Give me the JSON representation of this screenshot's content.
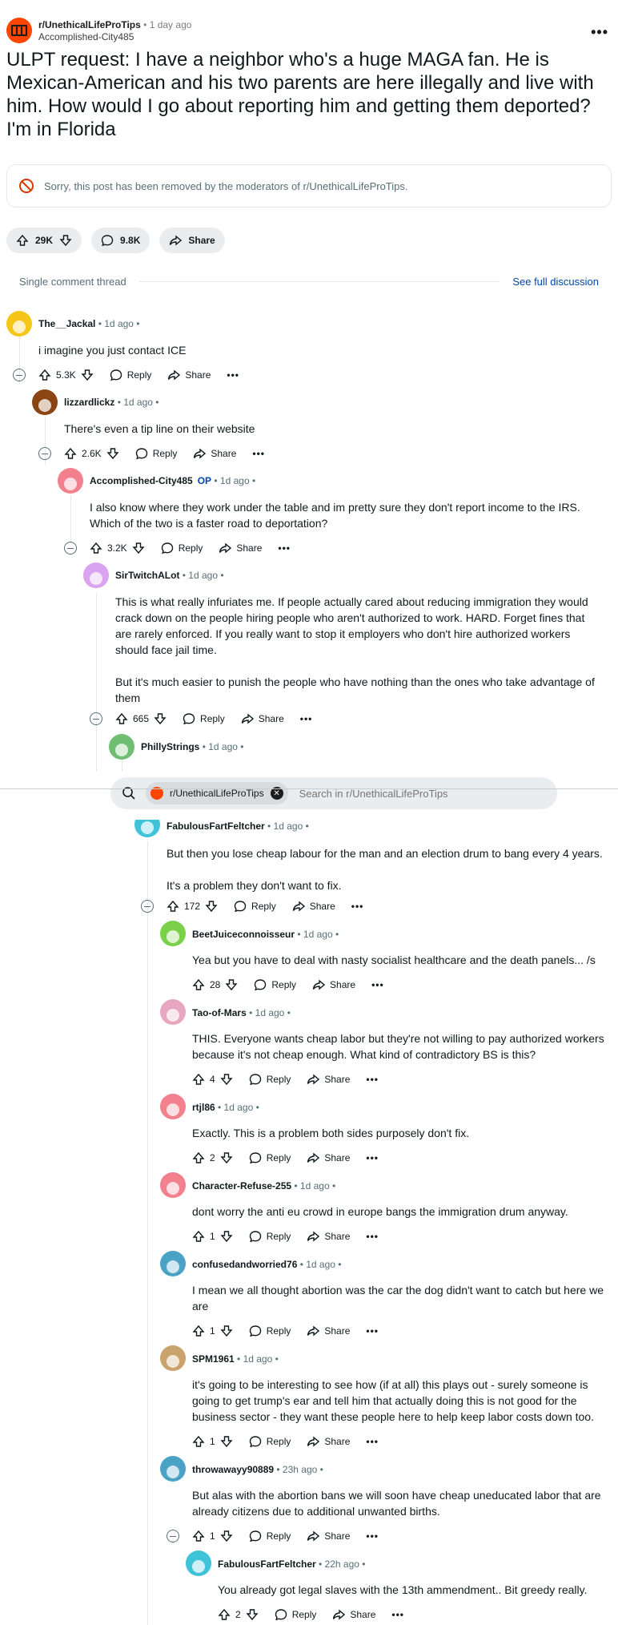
{
  "post": {
    "subreddit": "r/UnethicalLifeProTips",
    "time": "1 day ago",
    "author": "Accomplished-City485",
    "title": "ULPT request: I have a neighbor who's a huge MAGA fan. He is Mexican-American and his two parents are here illegally and live with him. How would I go about reporting him and getting them deported? I'm in Florida",
    "removed_notice": "Sorry, this post has been removed by the moderators of r/UnethicalLifeProTips.",
    "upvotes": "29K",
    "comments": "9.8K",
    "share_label": "Share"
  },
  "thread": {
    "label": "Single comment thread",
    "see_full": "See full discussion"
  },
  "labels": {
    "reply": "Reply",
    "share": "Share",
    "op": "OP",
    "sep": "•"
  },
  "search": {
    "chip": "r/UnethicalLifeProTips",
    "placeholder": "Search in r/UnethicalLifeProTips"
  },
  "comments": [
    {
      "author": "The__Jackal",
      "time": "1d ago",
      "body": [
        "i imagine you just contact ICE"
      ],
      "score": "5.3K",
      "avatar_color": "#f5c518"
    },
    {
      "author": "lizzardlickz",
      "time": "1d ago",
      "body": [
        "There's even a tip line on their website"
      ],
      "score": "2.6K",
      "avatar_color": "#8b4513"
    },
    {
      "author": "Accomplished-City485",
      "time": "1d ago",
      "op": true,
      "body": [
        "I also know where they work under the table and im pretty sure they don't report income to the IRS. Which of the two is a faster road to deportation?"
      ],
      "score": "3.2K",
      "avatar_color": "#f2808d"
    },
    {
      "author": "SirTwitchALot",
      "time": "1d ago",
      "body": [
        "This is what really infuriates me. If people actually cared about reducing immigration they would crack down on the people hiring people who aren't authorized to work. HARD. Forget fines that are rarely enforced. If you really want to stop it employers who don't hire authorized workers should face jail time.",
        "But it's much easier to punish the people who have nothing than the ones who take advantage of them"
      ],
      "score": "665",
      "avatar_color": "#d9a3f0"
    },
    {
      "author": "PhillyStrings",
      "time": "1d ago",
      "body": [],
      "score": "",
      "avatar_color": "#6fbf73"
    },
    {
      "author": "FabulousFartFeltcher",
      "time": "1d ago",
      "body": [
        "But then you lose cheap labour for the man and an election drum to bang every 4 years.",
        "It's a problem they don't want to fix."
      ],
      "score": "172",
      "avatar_color": "#3fc3d9"
    },
    {
      "author": "BeetJuiceconnoisseur",
      "time": "1d ago",
      "body": [
        "Yea but you have to deal with nasty socialist healthcare and the death panels... /s"
      ],
      "score": "28",
      "avatar_color": "#7bd04a"
    },
    {
      "author": "Tao-of-Mars",
      "time": "1d ago",
      "body": [
        "THIS. Everyone wants cheap labor but they're not willing to pay authorized workers because it's not cheap enough. What kind of contradictory BS is this?"
      ],
      "score": "4",
      "avatar_color": "#e8a7c0"
    },
    {
      "author": "rtjl86",
      "time": "1d ago",
      "body": [
        "Exactly. This is a problem both sides purposely don't fix."
      ],
      "score": "2",
      "avatar_color": "#f2808d"
    },
    {
      "author": "Character-Refuse-255",
      "time": "1d ago",
      "body": [
        "dont worry the anti eu crowd in europe bangs the immigration drum anyway."
      ],
      "score": "1",
      "avatar_color": "#f2808d"
    },
    {
      "author": "confusedandworried76",
      "time": "1d ago",
      "body": [
        "I mean we all thought abortion was the car the dog didn't want to catch but here we are"
      ],
      "score": "1",
      "avatar_color": "#4aa3c7"
    },
    {
      "author": "SPM1961",
      "time": "1d ago",
      "body": [
        "it's going to be interesting to see how (if at all) this plays out - surely someone is going to get trump's ear and tell him that actually doing this is not good for the business sector - they want these people here to help keep labor costs down too."
      ],
      "score": "1",
      "avatar_color": "#c9a36b"
    },
    {
      "author": "throwawayy90889",
      "time": "23h ago",
      "body": [
        "But alas with the abortion bans we will soon have cheap uneducated labor that are already citizens due to additional unwanted births."
      ],
      "score": "1",
      "avatar_color": "#4aa3c7"
    },
    {
      "author": "FabulousFartFeltcher",
      "time": "22h ago",
      "body": [
        "You already got legal slaves with the 13th ammendment.. Bit greedy really."
      ],
      "score": "2",
      "avatar_color": "#3fc3d9"
    }
  ],
  "colors": {
    "accent": "#ff4500",
    "link": "#0045ac",
    "pill": "#eaedef"
  }
}
